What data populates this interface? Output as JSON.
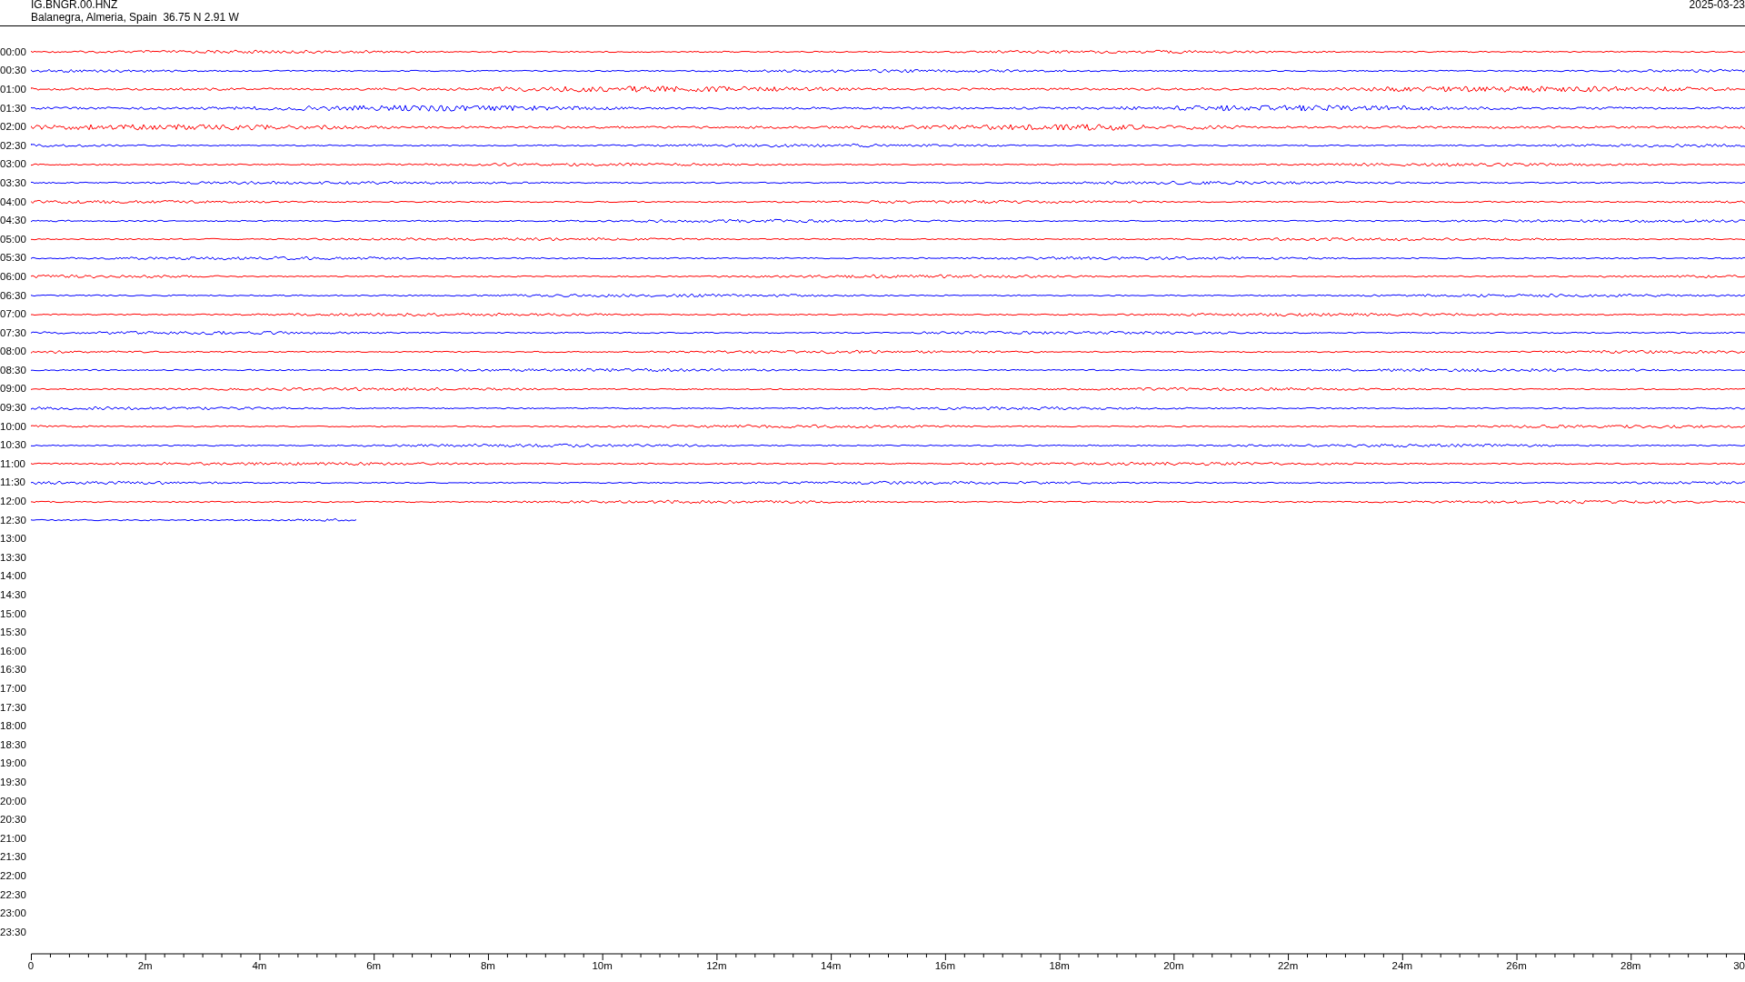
{
  "header": {
    "station": "IG.BNGR.00.HNZ",
    "location": "Balanegra, Almeria, Spain  36.75 N 2.91 W",
    "date": "2025-03-23"
  },
  "rows": [
    {
      "label": "00:00",
      "color": "#ff0000",
      "level": 1
    },
    {
      "label": "00:30",
      "color": "#0000ff",
      "level": 1
    },
    {
      "label": "01:00",
      "color": "#ff0000",
      "level": 1
    },
    {
      "label": "01:30",
      "color": "#0000ff",
      "level": 1
    },
    {
      "label": "02:00",
      "color": "#ff0000",
      "level": 1
    },
    {
      "label": "02:30",
      "color": "#0000ff",
      "level": 1
    },
    {
      "label": "03:00",
      "color": "#ff0000",
      "level": 1
    },
    {
      "label": "03:30",
      "color": "#0000ff",
      "level": 1
    },
    {
      "label": "04:00",
      "color": "#ff0000",
      "level": 1
    },
    {
      "label": "04:30",
      "color": "#0000ff",
      "level": 1
    },
    {
      "label": "05:00",
      "color": "#ff0000",
      "level": 1
    },
    {
      "label": "05:30",
      "color": "#0000ff",
      "level": 1
    },
    {
      "label": "06:00",
      "color": "#ff0000",
      "level": 1
    },
    {
      "label": "06:30",
      "color": "#0000ff",
      "level": 1
    },
    {
      "label": "07:00",
      "color": "#ff0000",
      "level": 1
    },
    {
      "label": "07:30",
      "color": "#0000ff",
      "level": 1
    },
    {
      "label": "08:00",
      "color": "#ff0000",
      "level": 1
    },
    {
      "label": "08:30",
      "color": "#0000ff",
      "level": 1
    },
    {
      "label": "09:00",
      "color": "#ff0000",
      "level": 1
    },
    {
      "label": "09:30",
      "color": "#0000ff",
      "level": 1
    },
    {
      "label": "10:00",
      "color": "#ff0000",
      "level": 1
    },
    {
      "label": "10:30",
      "color": "#0000ff",
      "level": 1
    },
    {
      "label": "11:00",
      "color": "#ff0000",
      "level": 1
    },
    {
      "label": "11:30",
      "color": "#0000ff",
      "level": 1
    },
    {
      "label": "12:00",
      "color": "#ff0000",
      "level": 1
    },
    {
      "label": "12:30",
      "color": "#0000ff",
      "level": 0.19
    },
    {
      "label": "13:00"
    },
    {
      "label": "13:30"
    },
    {
      "label": "14:00"
    },
    {
      "label": "14:30"
    },
    {
      "label": "15:00"
    },
    {
      "label": "15:30"
    },
    {
      "label": "16:00"
    },
    {
      "label": "16:30"
    },
    {
      "label": "17:00"
    },
    {
      "label": "17:30"
    },
    {
      "label": "18:00"
    },
    {
      "label": "18:30"
    },
    {
      "label": "19:00"
    },
    {
      "label": "19:30"
    },
    {
      "label": "20:00"
    },
    {
      "label": "20:30"
    },
    {
      "label": "21:00"
    },
    {
      "label": "21:30"
    },
    {
      "label": "22:00"
    },
    {
      "label": "22:30"
    },
    {
      "label": "23:00"
    },
    {
      "label": "23:30"
    }
  ],
  "axis": {
    "ticks": [
      "0",
      "2m",
      "4m",
      "6m",
      "8m",
      "10m",
      "12m",
      "14m",
      "16m",
      "18m",
      "20m",
      "22m",
      "24m",
      "26m",
      "28m",
      "30"
    ]
  }
}
